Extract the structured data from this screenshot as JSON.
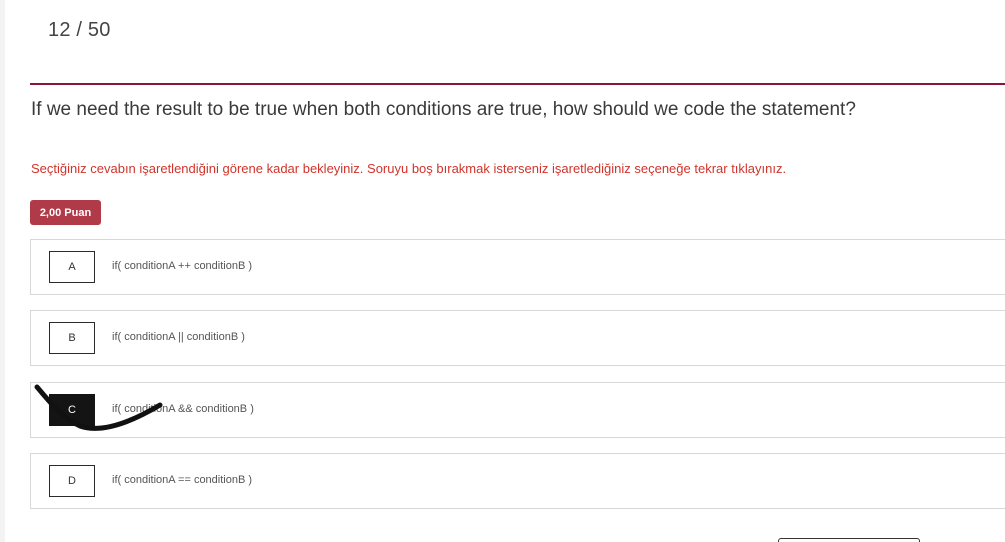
{
  "header": {
    "counter": "12 / 50"
  },
  "question": {
    "text": "If we need the result to be true when both conditions are true, how should we code the statement?",
    "warning": "Seçtiğiniz cevabın işaretlendiğini görene kadar bekleyiniz. Soruyu boş bırakmak isterseniz işaretlediğiniz seçeneğe tekrar tıklayınız.",
    "points": "2,00 Puan"
  },
  "options": [
    {
      "letter": "A",
      "text": "if( conditionA ++ conditionB )",
      "selected": false
    },
    {
      "letter": "B",
      "text": "if( conditionA || conditionB )",
      "selected": false
    },
    {
      "letter": "C",
      "text": "if( conditionA && conditionB )",
      "selected": true
    },
    {
      "letter": "D",
      "text": "if( conditionA == conditionB )",
      "selected": false
    }
  ],
  "colors": {
    "accent": "#8a1538",
    "warning": "#d0342c",
    "badge": "#b03a48",
    "selected": "#141414"
  }
}
